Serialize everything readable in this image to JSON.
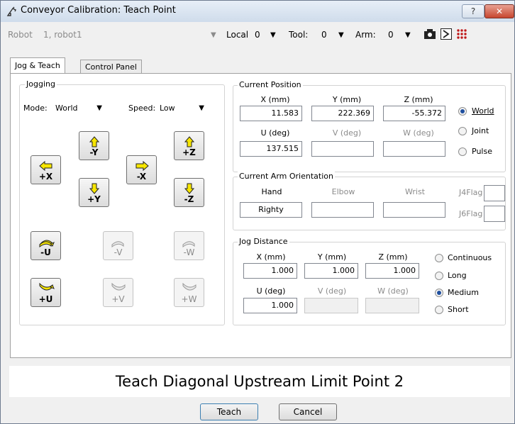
{
  "window": {
    "title": "Conveyor Calibration: Teach Point",
    "help_label": "?",
    "close_label": "✕"
  },
  "toolbar": {
    "robot_label": "Robot",
    "robot_value": "1, robot1",
    "local_label": "Local",
    "local_value": "0",
    "tool_label": "Tool:",
    "tool_value": "0",
    "arm_label": "Arm:",
    "arm_value": "0"
  },
  "tabs": [
    "Jog & Teach",
    "Control Panel"
  ],
  "jogging": {
    "title": "Jogging",
    "mode_label": "Mode:",
    "mode_value": "World",
    "speed_label": "Speed:",
    "speed_value": "Low",
    "buttons": {
      "plus_x": "+X",
      "minus_y": "-Y",
      "plus_y": "+Y",
      "minus_x": "-X",
      "plus_z": "+Z",
      "minus_z": "-Z",
      "minus_u": "-U",
      "plus_u": "+U",
      "minus_v": "-V",
      "plus_v": "+V",
      "minus_w": "-W",
      "plus_w": "+W"
    }
  },
  "current_position": {
    "title": "Current Position",
    "x_label": "X (mm)",
    "x": "11.583",
    "y_label": "Y (mm)",
    "y": "222.369",
    "z_label": "Z (mm)",
    "z": "-55.372",
    "u_label": "U (deg)",
    "u": "137.515",
    "v_label": "V (deg)",
    "v": "",
    "w_label": "W (deg)",
    "w": "",
    "modes": [
      "World",
      "Joint",
      "Pulse"
    ],
    "selected": "World"
  },
  "arm_orientation": {
    "title": "Current Arm Orientation",
    "hand_label": "Hand",
    "hand": "Righty",
    "elbow_label": "Elbow",
    "elbow": "",
    "wrist_label": "Wrist",
    "wrist": "",
    "j4_label": "J4Flag",
    "j6_label": "J6Flag"
  },
  "jog_distance": {
    "title": "Jog Distance",
    "x_label": "X (mm)",
    "x": "1.000",
    "y_label": "Y (mm)",
    "y": "1.000",
    "z_label": "Z (mm)",
    "z": "1.000",
    "u_label": "U (deg)",
    "u": "1.000",
    "v_label": "V (deg)",
    "w_label": "W (deg)",
    "options": [
      "Continuous",
      "Long",
      "Medium",
      "Short"
    ],
    "selected": "Medium"
  },
  "instruction": "Teach Diagonal Upstream Limit Point 2",
  "actions": {
    "teach": "Teach",
    "cancel": "Cancel"
  }
}
